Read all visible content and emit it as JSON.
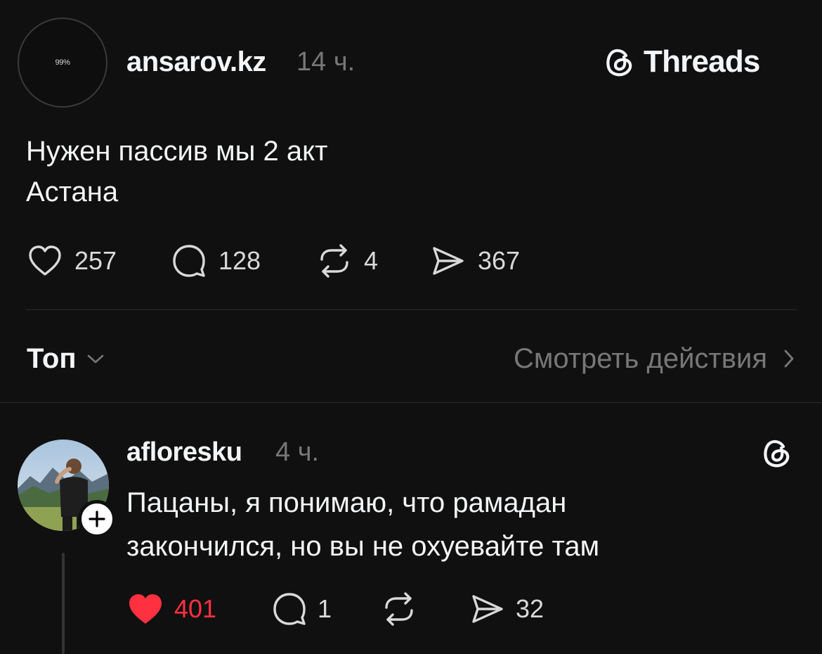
{
  "post": {
    "avatar_text": "99%",
    "username": "ansarov.kz",
    "time": "14 ч.",
    "brand_name": "Threads",
    "text_lines": [
      "Нужен пассив мы 2 акт",
      "Астана"
    ],
    "stats": {
      "likes": "257",
      "comments": "128",
      "reposts": "4",
      "shares": "367"
    }
  },
  "sort": {
    "label": "Топ",
    "activity_label": "Смотреть действия"
  },
  "reply": {
    "username": "afloresku",
    "time": "4 ч.",
    "text_lines": [
      "Пацаны, я понимаю, что рамадан",
      "закончился, но вы не охуевайте там"
    ],
    "stats": {
      "likes": "401",
      "comments": "1",
      "shares": "32"
    },
    "liked": true
  },
  "colors": {
    "background": "#101010",
    "like_red": "#ff3040",
    "muted": "#777777"
  }
}
